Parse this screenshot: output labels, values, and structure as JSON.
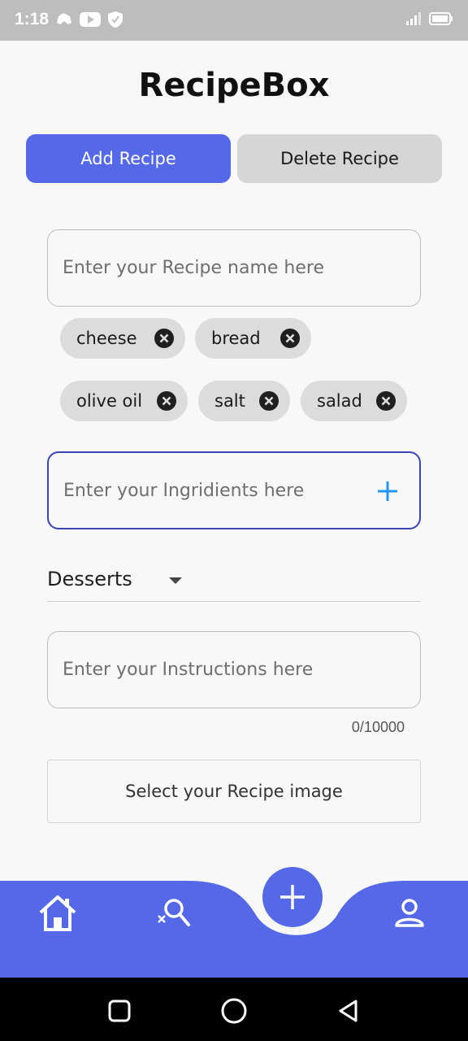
{
  "status_bar": {
    "time": "1:18"
  },
  "app": {
    "title": "RecipeBox"
  },
  "tabs": {
    "add": "Add Recipe",
    "delete": "Delete Recipe"
  },
  "recipe_name": {
    "placeholder": "Enter your Recipe name here"
  },
  "ingredients": {
    "chips": [
      "cheese",
      "bread",
      "olive oil",
      "salt",
      "salad"
    ],
    "placeholder": "Enter your Ingridients here"
  },
  "category": {
    "selected": "Desserts"
  },
  "instructions": {
    "placeholder": "Enter your Instructions here",
    "counter": "0/10000"
  },
  "image": {
    "label": "Select your Recipe image"
  },
  "bottom_nav": {
    "items": [
      "home-icon",
      "search-icon",
      "add-icon",
      "profile-icon"
    ]
  },
  "colors": {
    "accent": "#5468e8",
    "focus_border": "#3a45b5",
    "chip_bg": "#dcdcdc",
    "status_bar": "#bdbdbd"
  }
}
